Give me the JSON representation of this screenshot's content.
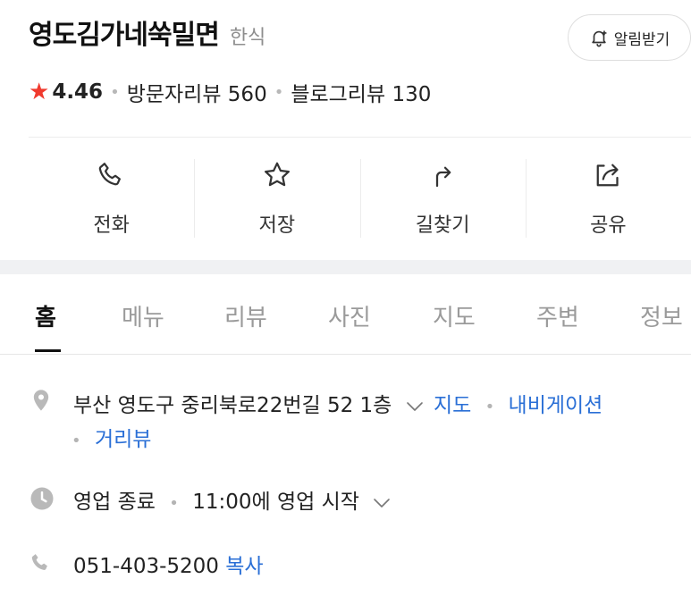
{
  "place": {
    "name": "영도김가네쑥밀면",
    "category": "한식",
    "alarm_label": "알림받기",
    "rating": "4.46",
    "visitor_reviews": "방문자리뷰 560",
    "blog_reviews": "블로그리뷰 130"
  },
  "actions": [
    {
      "label": "전화",
      "icon": "phone-icon"
    },
    {
      "label": "저장",
      "icon": "star-outline-icon"
    },
    {
      "label": "길찾기",
      "icon": "directions-arrow-icon"
    },
    {
      "label": "공유",
      "icon": "share-icon"
    }
  ],
  "tabs": [
    {
      "label": "홈",
      "active": true
    },
    {
      "label": "메뉴",
      "active": false
    },
    {
      "label": "리뷰",
      "active": false
    },
    {
      "label": "사진",
      "active": false
    },
    {
      "label": "지도",
      "active": false
    },
    {
      "label": "주변",
      "active": false
    },
    {
      "label": "정보",
      "active": false
    }
  ],
  "address": {
    "text": "부산 영도구 중리북로22번길 52 1층",
    "map_link": "지도",
    "nav_link": "내비게이션",
    "street_view_link": "거리뷰"
  },
  "hours": {
    "status": "영업 종료",
    "opening": "11:00에 영업 시작"
  },
  "phone": {
    "number": "051-403-5200",
    "copy_label": "복사"
  },
  "colors": {
    "star": "#f03a2e",
    "link": "#2a6fd6",
    "band": "#f0f1f3"
  }
}
